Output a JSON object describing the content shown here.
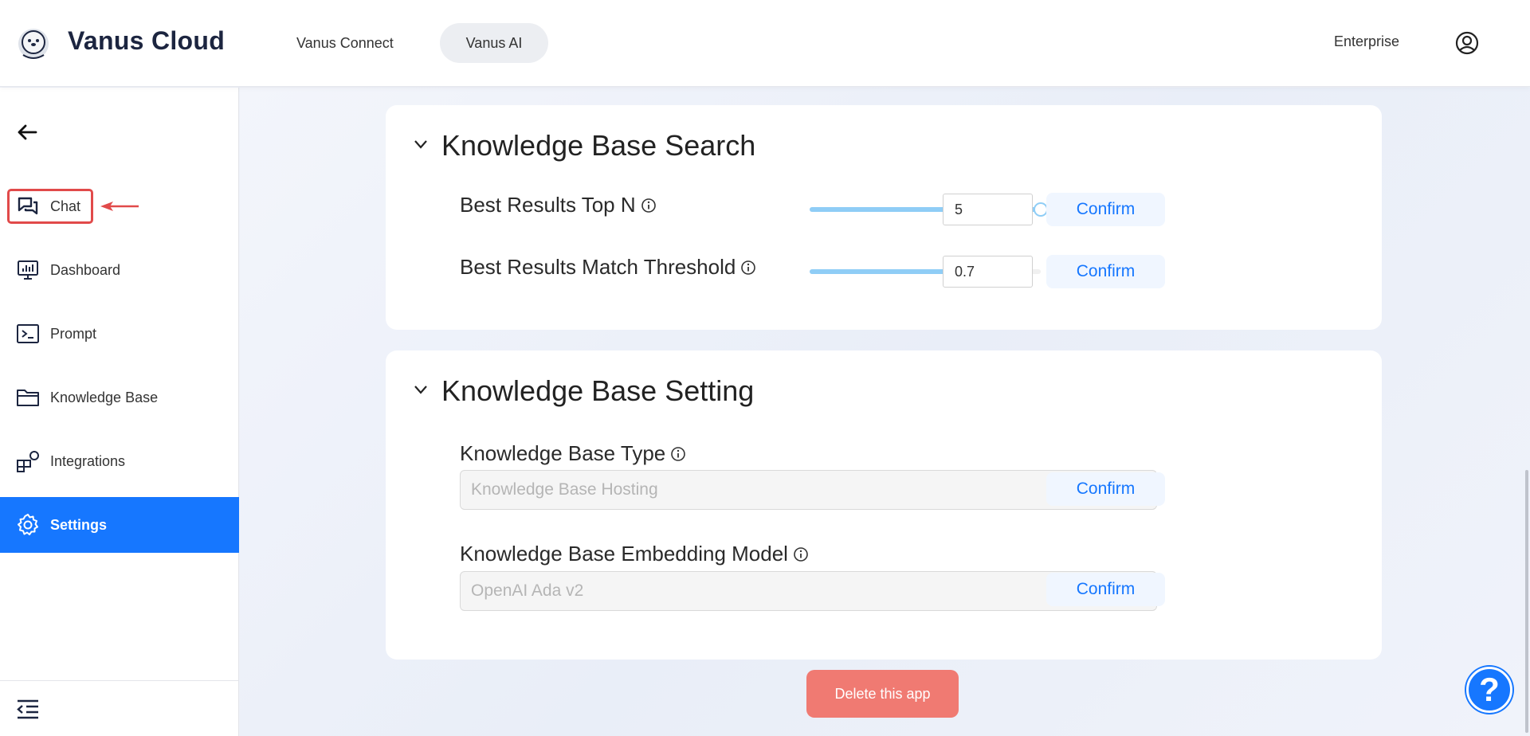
{
  "header": {
    "brand": "Vanus Cloud",
    "tabs": [
      {
        "label": "Vanus Connect"
      },
      {
        "label": "Vanus AI"
      }
    ],
    "plan": "Enterprise"
  },
  "sidebar": {
    "items": [
      {
        "label": "Chat",
        "icon": "chat-icon"
      },
      {
        "label": "Dashboard",
        "icon": "dashboard-icon"
      },
      {
        "label": "Prompt",
        "icon": "terminal-icon"
      },
      {
        "label": "Knowledge Base",
        "icon": "folder-icon"
      },
      {
        "label": "Integrations",
        "icon": "integrations-icon"
      },
      {
        "label": "Settings",
        "icon": "gear-icon"
      }
    ],
    "active": "Settings"
  },
  "search_section": {
    "title": "Knowledge Base Search",
    "top_n": {
      "label": "Best Results Top N",
      "value": "5",
      "slider_fraction": 1.0,
      "confirm": "Confirm"
    },
    "threshold": {
      "label": "Best Results Match Threshold",
      "value": "0.7",
      "slider_fraction": 0.7,
      "confirm": "Confirm"
    }
  },
  "setting_section": {
    "title": "Knowledge Base Setting",
    "type": {
      "label": "Knowledge Base Type",
      "value": "Knowledge Base Hosting",
      "confirm": "Confirm"
    },
    "model": {
      "label": "Knowledge Base Embedding Model",
      "value": "OpenAI Ada v2",
      "confirm": "Confirm"
    }
  },
  "delete_label": "Delete this app",
  "help_label": "?",
  "colors": {
    "accent": "#1677ff",
    "danger": "#f07a72",
    "slider": "#8fcdf6",
    "annotation": "#e14a4a"
  }
}
